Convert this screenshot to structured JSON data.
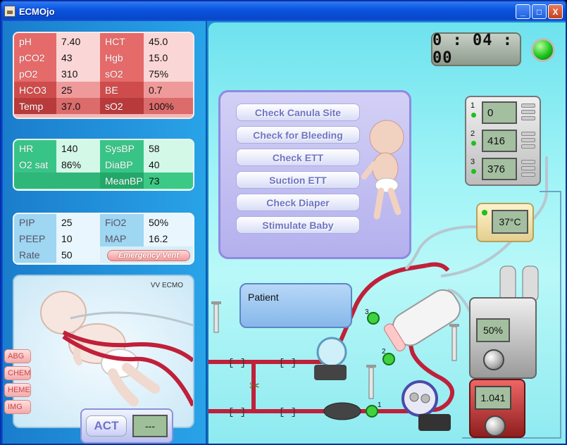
{
  "window": {
    "title": "ECMOjo",
    "minimize_glyph": "_",
    "maximize_glyph": "□",
    "close_glyph": "X"
  },
  "blood_gas": {
    "rows": [
      {
        "l1": "pH",
        "v1": "7.40",
        "l2": "HCT",
        "v2": "45.0"
      },
      {
        "l1": "pCO2",
        "v1": "43",
        "l2": "Hgb",
        "v2": "15.0"
      },
      {
        "l1": "pO2",
        "v1": "310",
        "l2": "sO2",
        "v2": "75%"
      },
      {
        "l1": "HCO3",
        "v1": "25",
        "l2": "BE",
        "v2": "0.7"
      },
      {
        "l1": "Temp",
        "v1": "37.0",
        "l2": "sO2",
        "v2": "100%"
      }
    ]
  },
  "vitals": {
    "rows": [
      {
        "l1": "HR",
        "v1": "140",
        "l2": "SysBP",
        "v2": "58"
      },
      {
        "l1": "O2 sat",
        "v1": "86%",
        "l2": "DiaBP",
        "v2": "40"
      },
      {
        "l1": "",
        "v1": "",
        "l2": "MeanBP",
        "v2": "73"
      }
    ]
  },
  "ventilator": {
    "rows": [
      {
        "l1": "PIP",
        "v1": "25",
        "l2": "FiO2",
        "v2": "50%"
      },
      {
        "l1": "PEEP",
        "v1": "10",
        "l2": "MAP",
        "v2": "16.2"
      },
      {
        "l1": "Rate",
        "v1": "50"
      }
    ],
    "emergency_label": "Emergency Vent"
  },
  "baby_panel": {
    "mode_label": "VV ECMO"
  },
  "lab_tabs": [
    "ABG",
    "CHEM",
    "HEME",
    "IMG"
  ],
  "act": {
    "button_label": "ACT",
    "value": "---"
  },
  "timer": "0 : 04 : 00",
  "actions": [
    "Check Canula Site",
    "Check for Bleeding",
    "Check ETT",
    "Suction ETT",
    "Check Diaper",
    "Stimulate Baby"
  ],
  "patient_label": "Patient",
  "pressure_monitor": [
    {
      "index": "1",
      "value": "0"
    },
    {
      "index": "2",
      "value": "416"
    },
    {
      "index": "3",
      "value": "376"
    }
  ],
  "heater_value": "37°C",
  "gas_blender_value": "50%",
  "pump_value": "1.041",
  "circuit_markers": [
    "1",
    "2",
    "3"
  ],
  "colors": {
    "blood_red": "#c0203a",
    "status_led": "#1ec41e"
  }
}
